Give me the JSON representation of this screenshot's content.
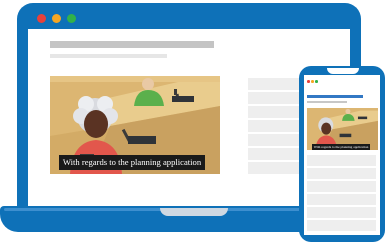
{
  "illustration": {
    "description_icon": "laptop-and-phone-icon",
    "caption": "With regards to the planning application",
    "colors": {
      "device_blue": "#0e71b8",
      "window_dot_red": "#e8413b",
      "window_dot_yellow": "#f5a623",
      "window_dot_green": "#31b24a",
      "placeholder_grey": "#c4c4c4",
      "caption_background": "#1a1a1a"
    }
  }
}
